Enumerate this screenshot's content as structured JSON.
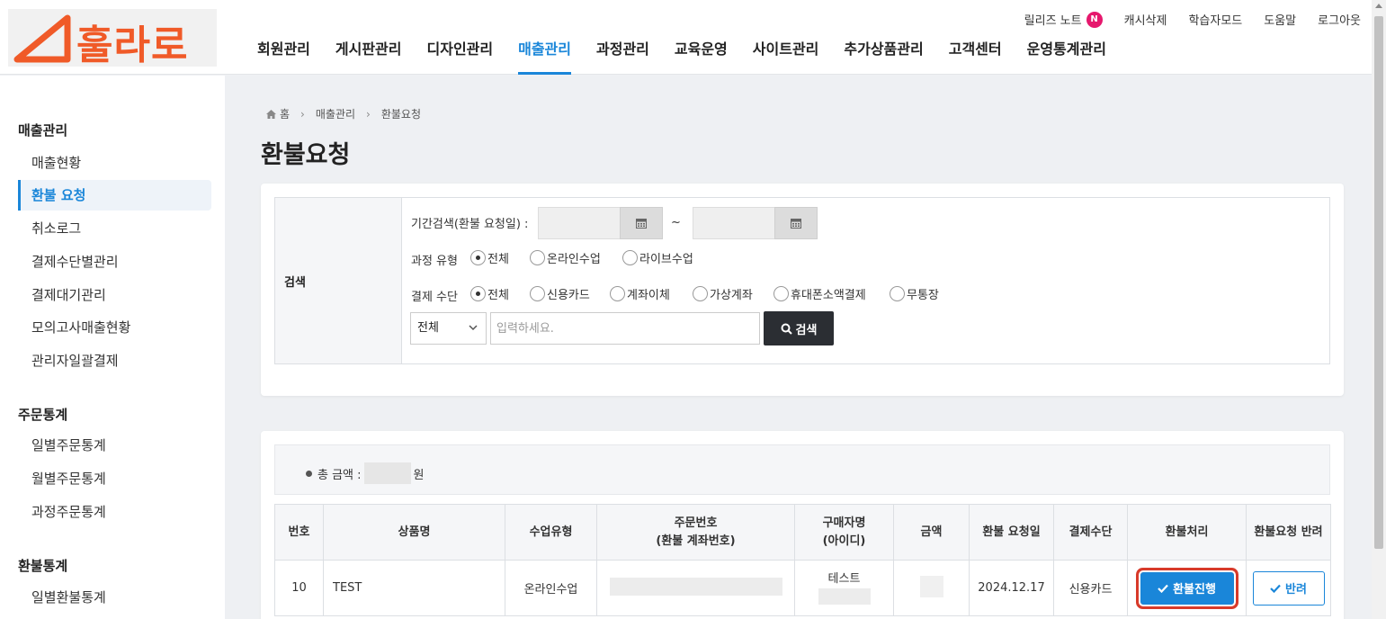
{
  "header": {
    "logo_text": "훌라로",
    "top_links": [
      "릴리즈 노트",
      "캐시삭제",
      "학습자모드",
      "도움말",
      "로그아웃"
    ],
    "badge": "N",
    "nav": [
      "회원관리",
      "게시판관리",
      "디자인관리",
      "매출관리",
      "과정관리",
      "교육운영",
      "사이트관리",
      "추가상품관리",
      "고객센터",
      "운영통계관리"
    ],
    "active_nav": "매출관리"
  },
  "sidebar": {
    "groups": [
      {
        "title": "매출관리",
        "items": [
          "매출현황",
          "환불 요청",
          "취소로그",
          "결제수단별관리",
          "결제대기관리",
          "모의고사매출현황",
          "관리자일괄결제"
        ]
      },
      {
        "title": "주문통계",
        "items": [
          "일별주문통계",
          "월별주문통계",
          "과정주문통계"
        ]
      },
      {
        "title": "환불통계",
        "items": [
          "일별환불통계"
        ]
      }
    ],
    "active_item": "환불 요청"
  },
  "breadcrumb": [
    "홈",
    "매출관리",
    "환불요청"
  ],
  "page_title": "환불요청",
  "search": {
    "label": "검색",
    "period_label": "기간검색(환불 요청일) :",
    "tilde": "~",
    "course_type_label": "과정 유형",
    "course_types": [
      "전체",
      "온라인수업",
      "라이브수업"
    ],
    "payment_label": "결제 수단",
    "payment_methods": [
      "전체",
      "신용카드",
      "계좌이체",
      "가상계좌",
      "휴대폰소액결제",
      "무통장"
    ],
    "select_value": "전체",
    "input_placeholder": "입력하세요.",
    "button": "검색"
  },
  "list": {
    "total_label": "총 금액 :",
    "total_unit": "원",
    "columns": [
      "번호",
      "상품명",
      "수업유형",
      "주문번호",
      "(환불 계좌번호)",
      "구매자명",
      "(아이디)",
      "금액",
      "환불 요청일",
      "결제수단",
      "환불처리",
      "환불요청 반려"
    ],
    "rows": [
      {
        "no": "10",
        "product": "TEST",
        "class_type": "온라인수업",
        "buyer": "테스트",
        "date": "2024.12.17",
        "payment": "신용카드",
        "refund_btn": "환불진행",
        "reject_btn": "반려"
      }
    ]
  },
  "colors": {
    "accent": "#1a86d9",
    "logo": "#f05a28",
    "highlight": "#d83a2a",
    "badge": "#e6186d"
  }
}
